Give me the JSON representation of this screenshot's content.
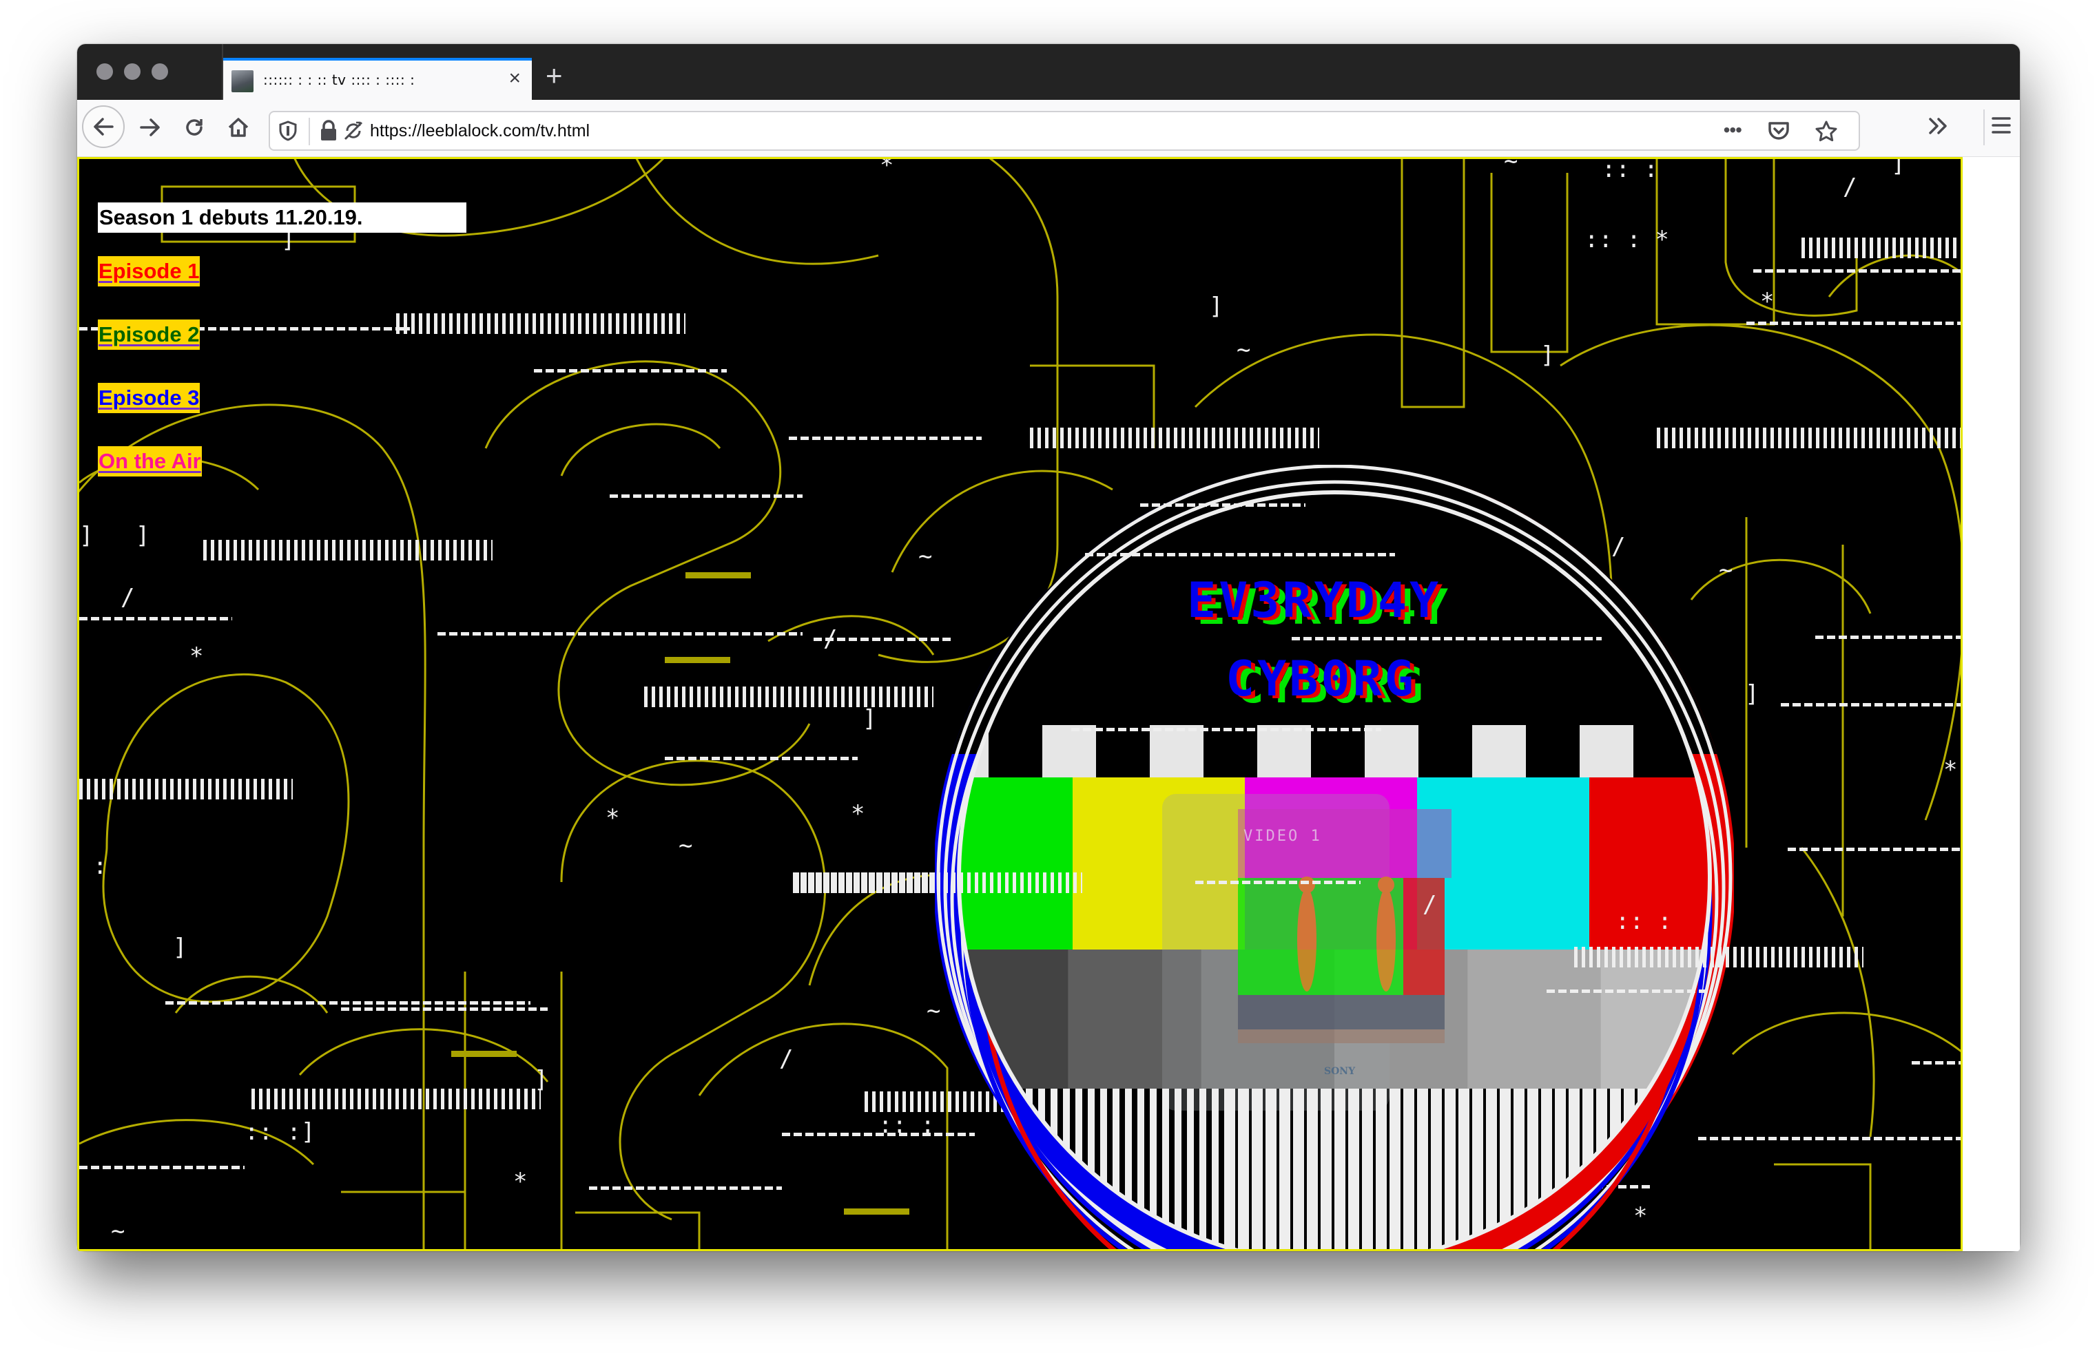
{
  "browser": {
    "tab": {
      "title": ":::::: : : :: tv :::: : :::: :",
      "close_icon": "×",
      "favicon": "cyborg-head-favicon"
    },
    "new_tab_icon": "+",
    "nav": {
      "back_icon": "arrow-left",
      "forward_icon": "arrow-right",
      "reload_icon": "reload",
      "home_icon": "home"
    },
    "url_bar": {
      "url": "https://leeblalock.com/tv.html",
      "page_actions_icon": "•••"
    },
    "accent_color": "#0a84ff"
  },
  "page": {
    "announcement": "Season 1 debuts 11.20.19.",
    "links": [
      {
        "label": "Episode 1",
        "color": "#ff0000"
      },
      {
        "label": "Episode 2",
        "color": "#006400"
      },
      {
        "label": "Episode 3",
        "color": "#0000ff"
      },
      {
        "label": "On the Air",
        "color": "#ff1493"
      }
    ],
    "link_background": "#ffd700",
    "background_color": "#000000",
    "outline_color": "#b5ad00",
    "test_card": {
      "title_line1": "EV3RYD4Y",
      "title_line2": "CYB0RG",
      "screen_label": "VIDEO 1",
      "tv_brand": "SONY",
      "color_bars": [
        "#00e600",
        "#e6e600",
        "#e600e6",
        "#00e6e6",
        "#e60000"
      ],
      "gray_steps": [
        "#434343",
        "#5e5e5e",
        "#7a7a7a",
        "#969696",
        "#a8a8a8",
        "#bcbcbc"
      ]
    }
  }
}
